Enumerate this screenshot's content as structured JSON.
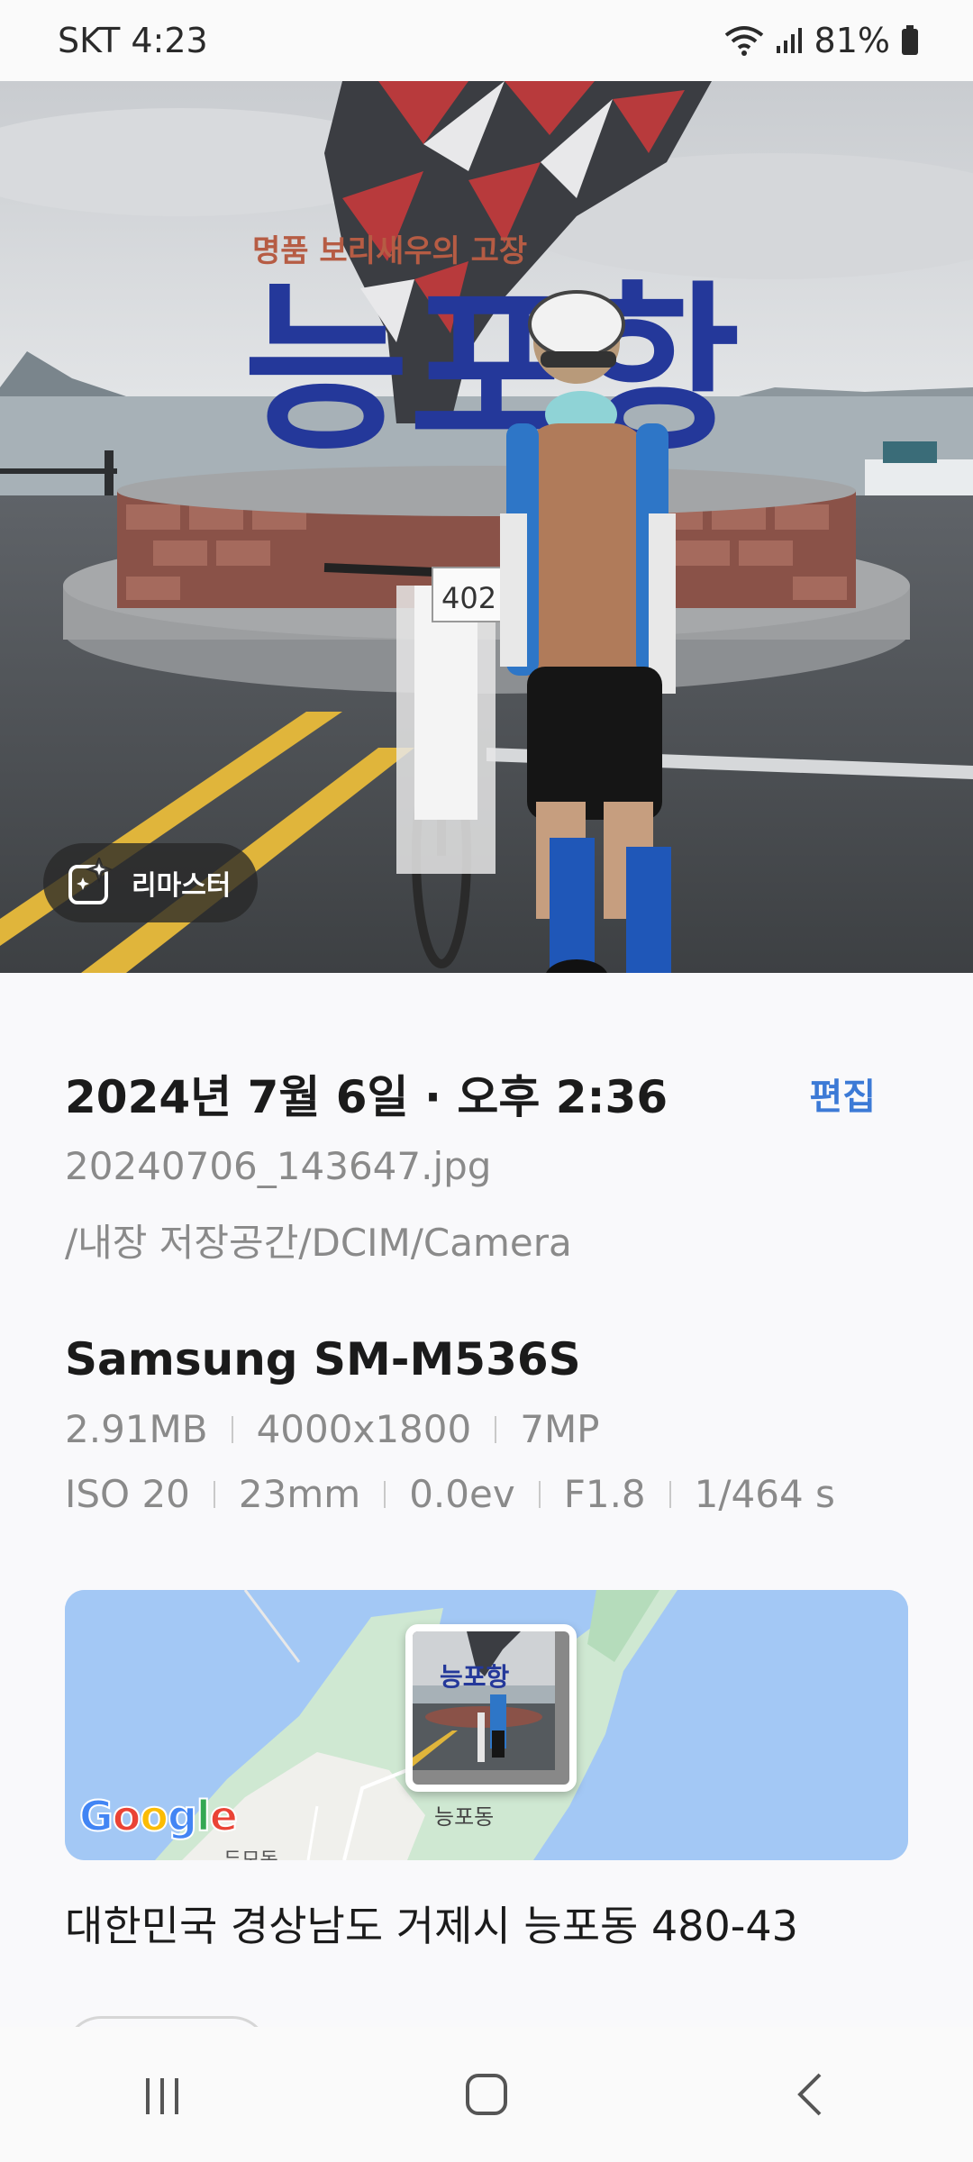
{
  "status_bar": {
    "carrier_time": "SKT 4:23",
    "battery": "81%",
    "icons": [
      "wifi-icon",
      "signal-icon",
      "battery-icon"
    ]
  },
  "photo": {
    "sign_text": "능포항",
    "sign_subtitle": "명품 보리새우의 고장",
    "bike_number": "402"
  },
  "remaster": {
    "label": "리마스터",
    "icon": "remaster-sparkle-icon"
  },
  "details": {
    "date": "2024년 7월 6일 · 오후 2:36",
    "edit_label": "편집",
    "file_name": "20240706_143647.jpg",
    "file_path": "/내장 저장공간/DCIM/Camera",
    "device": "Samsung SM-M536S",
    "size": "2.91MB",
    "resolution": "4000x1800",
    "megapixels": "7MP",
    "iso": "ISO 20",
    "focal": "23mm",
    "exposure": "0.0ev",
    "aperture": "F1.8",
    "shutter": "1/464 s",
    "address": "대한민국 경상남도 거제시 능포동 480-43"
  },
  "map": {
    "place_label": "능포동",
    "sub_label": "두모동",
    "logo": "Google"
  },
  "colors": {
    "accent": "#3c7ad6",
    "muted_text": "#8a8a8a",
    "map_water": "#a3c8f5"
  },
  "nav_bar": {
    "icons": [
      "recent-apps-icon",
      "home-icon",
      "back-icon"
    ]
  }
}
